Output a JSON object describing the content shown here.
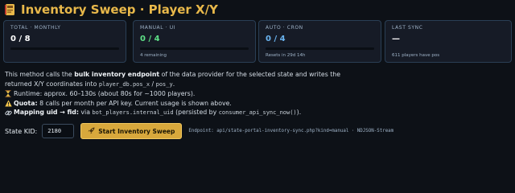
{
  "page": {
    "title": "Inventory Sweep · Player X/Y",
    "icon": "sweep-notebook-icon"
  },
  "cards": [
    {
      "label": "TOTAL · MONTHLY",
      "value": "0 / 8",
      "value_color": "#ffffff",
      "progress": 0,
      "sub": ""
    },
    {
      "label": "MANUAL · UI",
      "value": "0 / 4",
      "value_color": "#5ee087",
      "progress": 0,
      "sub": "4 remaining"
    },
    {
      "label": "AUTO · CRON",
      "value": "0 / 4",
      "value_color": "#6ab4f0",
      "progress": 0,
      "sub": "Resets in 29d 14h"
    },
    {
      "label": "LAST SYNC",
      "value": "—",
      "value_color": "#ffffff",
      "progress": null,
      "sub": "611 players have pos"
    }
  ],
  "description": {
    "intro_1": "This method calls the ",
    "intro_bold": "bulk inventory endpoint",
    "intro_2": " of the data provider for the selected state and writes the",
    "intro_3": "returned X/Y coordinates into ",
    "intro_code_1": "player_db.pos_x",
    "intro_4": " / ",
    "intro_code_2": "pos_y",
    "intro_5": ".",
    "runtime_icon": "hourglass-icon",
    "runtime_text": "Runtime: approx. 60–130s (about 80s for ~1000 players).",
    "quota_icon": "warning-icon",
    "quota_bold": "Quota:",
    "quota_text": " 8 calls per month per API key. Current usage is shown above.",
    "mapping_icon": "link-icon",
    "mapping_bold": "Mapping uid → fid:",
    "mapping_text_1": " via ",
    "mapping_code_1": "bot_players.internal_uid",
    "mapping_text_2": " (persisted by ",
    "mapping_code_2": "consumer_api_sync_now()",
    "mapping_text_3": ")."
  },
  "controls": {
    "kid_label": "State KID:",
    "kid_value": "2180",
    "start_label": "Start Inventory Sweep",
    "start_icon": "rocket-icon",
    "endpoint_text": "Endpoint: api/state-portal-inventory-sync.php?kind=manual · NDJSON-Stream"
  },
  "colors": {
    "accent": "#e8b84a",
    "card_border": "#2a3f55",
    "button": "#d8a83c",
    "green": "#5ee087",
    "blue": "#6ab4f0"
  }
}
